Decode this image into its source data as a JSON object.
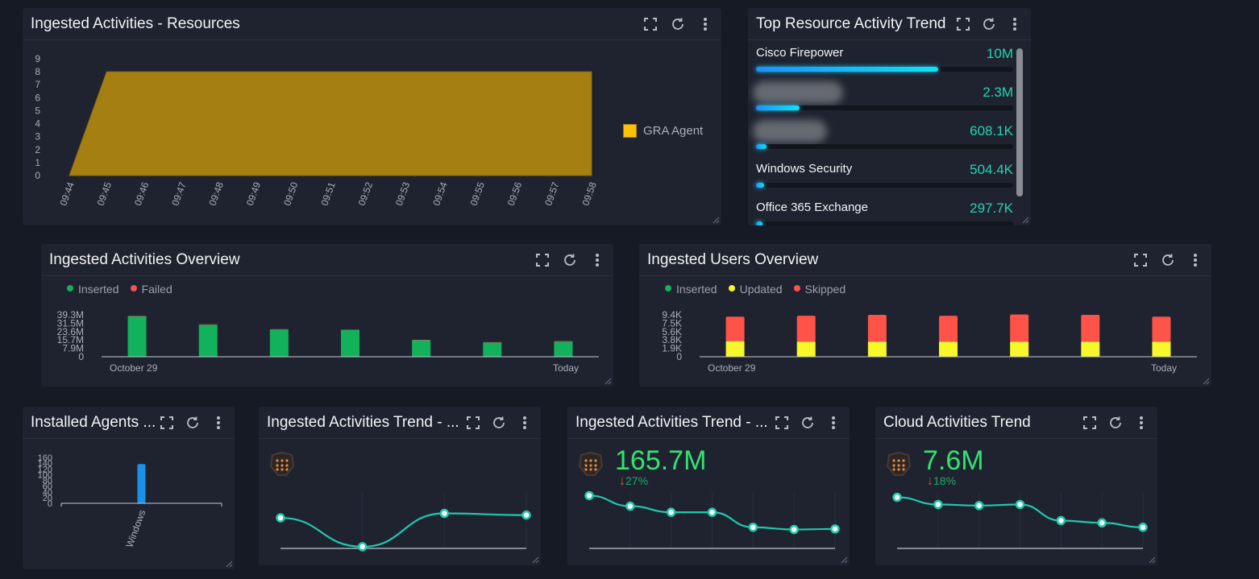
{
  "widgets": {
    "resources": {
      "title": "Ingested Activities - Resources",
      "legend": "GRA Agent"
    },
    "top_resources": {
      "title": "Top Resource Activity Trend",
      "items": [
        {
          "name": "Cisco Firepower",
          "value": "10M",
          "fraction": 0.71,
          "blurred": false
        },
        {
          "name": "",
          "value": "2.3M",
          "fraction": 0.17,
          "blurred": true
        },
        {
          "name": "",
          "value": "608.1K",
          "fraction": 0.04,
          "blurred": true
        },
        {
          "name": "Windows Security",
          "value": "504.4K",
          "fraction": 0.03,
          "blurred": false
        },
        {
          "name": "Office 365 Exchange",
          "value": "297.7K",
          "fraction": 0.02,
          "blurred": false
        }
      ]
    },
    "activities_overview": {
      "title": "Ingested Activities Overview",
      "legend": [
        "Inserted",
        "Failed"
      ]
    },
    "users_overview": {
      "title": "Ingested Users Overview",
      "legend": [
        "Inserted",
        "Updated",
        "Skipped"
      ]
    },
    "installed_agents": {
      "title": "Installed Agents ..."
    },
    "trend1": {
      "title": "Ingested Activities Trend - ..."
    },
    "trend2": {
      "title": "Ingested Activities Trend - ...",
      "value": "165.7M",
      "delta": "27%",
      "delta_direction": "down"
    },
    "cloud": {
      "title": "Cloud Activities Trend",
      "value": "7.6M",
      "delta": "18%",
      "delta_direction": "down"
    }
  },
  "colors": {
    "gra_agent": "#a67f12",
    "gra_agent_legend": "#ffc107",
    "inserted": "#12b25c",
    "failed": "#f05555",
    "updated": "#f7f72a",
    "skipped": "#ff5248",
    "windows_bar": "#1c8fe6",
    "trend_line": "#1ec9ad",
    "kpi_value": "#2fe46f"
  },
  "chart_data": [
    {
      "id": "resources",
      "type": "area",
      "title": "Ingested Activities - Resources",
      "x": [
        "09:44",
        "09:45",
        "09:46",
        "09:47",
        "09:48",
        "09:49",
        "09:50",
        "09:51",
        "09:52",
        "09:53",
        "09:54",
        "09:55",
        "09:56",
        "09:57",
        "09:58"
      ],
      "series": [
        {
          "name": "GRA Agent",
          "values": [
            0,
            8,
            8,
            8,
            8,
            8,
            8,
            8,
            8,
            8,
            8,
            8,
            8,
            8,
            8
          ]
        }
      ],
      "yticks": [
        "0",
        "1",
        "2",
        "3",
        "4",
        "5",
        "6",
        "7",
        "8",
        "9"
      ],
      "ylim": [
        0,
        9
      ],
      "legend": "right"
    },
    {
      "id": "activities_overview",
      "type": "bar",
      "stacked": true,
      "title": "Ingested Activities Overview",
      "categories": [
        "October 29",
        "",
        "",
        "",
        "",
        "",
        "Today"
      ],
      "series": [
        {
          "name": "Inserted",
          "values": [
            38.0,
            30.0,
            25.5,
            25.0,
            15.5,
            13.3,
            14.2
          ]
        },
        {
          "name": "Failed",
          "values": [
            0.4,
            0.4,
            0.4,
            0.4,
            0.4,
            0.4,
            0.4
          ]
        }
      ],
      "yticks": [
        "0",
        "7.9M",
        "15.7M",
        "23.6M",
        "31.5M",
        "39.3M"
      ],
      "ylim": [
        0,
        39.3
      ],
      "unit": "M",
      "legend": "top-left"
    },
    {
      "id": "users_overview",
      "type": "bar",
      "stacked": true,
      "title": "Ingested Users Overview",
      "categories": [
        "October 29",
        "",
        "",
        "",
        "",
        "",
        "Today"
      ],
      "series": [
        {
          "name": "Inserted",
          "values": [
            0,
            0,
            0,
            0,
            0,
            0,
            0
          ]
        },
        {
          "name": "Updated",
          "values": [
            3.5,
            3.4,
            3.4,
            3.4,
            3.4,
            3.4,
            3.4
          ]
        },
        {
          "name": "Skipped",
          "values": [
            5.5,
            5.8,
            6.0,
            5.8,
            6.1,
            6.0,
            5.6
          ]
        }
      ],
      "yticks": [
        "0",
        "1.9K",
        "3.8K",
        "5.6K",
        "7.5K",
        "9.4K"
      ],
      "ylim": [
        0,
        9.4
      ],
      "unit": "K",
      "legend": "top-left"
    },
    {
      "id": "installed_agents",
      "type": "bar",
      "title": "Installed Agents ...",
      "categories": [
        "Windows"
      ],
      "values": [
        137
      ],
      "yticks": [
        "0",
        "20",
        "40",
        "60",
        "80",
        "100",
        "120",
        "140",
        "160"
      ],
      "ylim": [
        0,
        160
      ]
    },
    {
      "id": "trend1",
      "type": "line",
      "title": "Ingested Activities Trend - ...",
      "values": [
        0.55,
        0.03,
        0.63,
        0.6
      ],
      "ylim": [
        0,
        1
      ]
    },
    {
      "id": "trend2",
      "type": "line",
      "title": "Ingested Activities Trend - ...",
      "values": [
        0.95,
        0.76,
        0.65,
        0.65,
        0.38,
        0.34,
        0.35
      ],
      "ylim": [
        0,
        1
      ]
    },
    {
      "id": "cloud",
      "type": "line",
      "title": "Cloud Activities Trend",
      "values": [
        0.92,
        0.79,
        0.77,
        0.79,
        0.5,
        0.46,
        0.38
      ],
      "ylim": [
        0,
        1
      ]
    }
  ]
}
